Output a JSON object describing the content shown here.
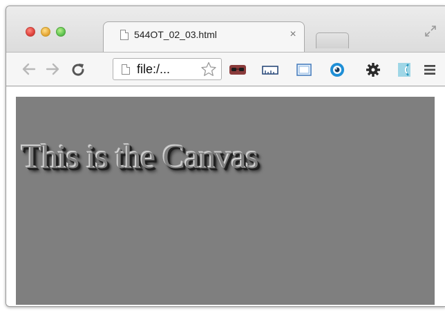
{
  "browser": {
    "tab": {
      "title": "544OT_02_03.html",
      "close_glyph": "×",
      "icon": "page-icon"
    },
    "new_tab_icon": "new-tab-icon",
    "fullscreen_icon": "fullscreen-icon",
    "toolbar": {
      "back_icon": "back-arrow-icon",
      "forward_icon": "forward-arrow-icon",
      "reload_icon": "reload-icon",
      "address": {
        "url_text": "file:/...",
        "page_icon": "page-icon",
        "bookmark_icon": "star-icon"
      },
      "extensions": [
        "mask-extension-icon",
        "ruler-extension-icon",
        "screen-capture-extension-icon",
        "eye-extension-icon",
        "gear-icon",
        "rainbow-extension-icon",
        "menu-icon"
      ]
    }
  },
  "page": {
    "canvas": {
      "text": "This is the Canvas",
      "background_color": "#7f7f7f",
      "text_effect": "embossed shadow"
    }
  },
  "colors": {
    "titlebar": "#e4e4e4",
    "toolbar": "#f6f6f6",
    "canvas": "#7f7f7f",
    "close_button": "#e0443e",
    "minimize_button": "#e8a93b",
    "maximize_button": "#62c554"
  }
}
